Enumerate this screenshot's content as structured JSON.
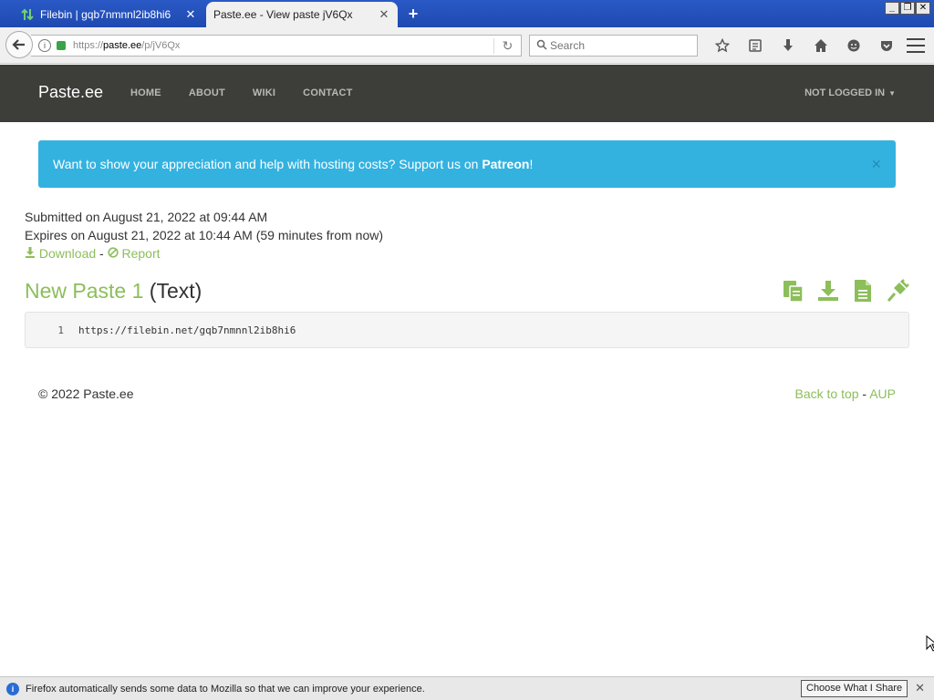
{
  "browser": {
    "tabs": [
      {
        "title": "Filebin | gqb7nmnnl2ib8hi6",
        "active": false,
        "icon": "filebin-arrows-icon"
      },
      {
        "title": "Paste.ee - View paste jV6Qx",
        "active": true,
        "icon": "none"
      }
    ],
    "new_tab_label": "+",
    "url_scheme": "https://",
    "url_host": "paste.ee",
    "url_path": "/p/jV6Qx",
    "search_placeholder": "Search",
    "toolbar_icons": [
      "bookmark-star-icon",
      "reading-list-icon",
      "download-icon",
      "home-icon",
      "smiley-icon",
      "pocket-icon"
    ],
    "window_controls": [
      "_",
      "❐",
      "✕"
    ]
  },
  "site": {
    "brand": "Paste.ee",
    "nav": [
      "HOME",
      "ABOUT",
      "WIKI",
      "CONTACT"
    ],
    "login": "NOT LOGGED IN",
    "alert_text": "Want to show your appreciation and help with hosting costs? Support us on ",
    "alert_link": "Patreon",
    "alert_end": "!",
    "alert_close": "×",
    "accent_color": "#8cbe5a",
    "alert_color": "#33b2e0"
  },
  "paste": {
    "submitted": "Submitted on August 21, 2022 at 09:44 AM",
    "expires": "Expires on August 21, 2022 at 10:44 AM (59 minutes from now)",
    "download_label": "Download",
    "link_sep": " - ",
    "report_label": "Report",
    "name": "New Paste 1",
    "type": "(Text)",
    "actions": [
      "copy-icon",
      "download-icon",
      "raw-document-icon",
      "plug-icon"
    ],
    "lines": [
      {
        "number": "1",
        "text": "https://filebin.net/gqb7nmnnl2ib8hi6"
      }
    ]
  },
  "footer": {
    "copyright": "© 2022 Paste.ee",
    "back_to_top": "Back to top",
    "sep": " - ",
    "aup": "AUP"
  },
  "notification": {
    "text": "Firefox automatically sends some data to Mozilla so that we can improve your experience.",
    "button": "Choose What I Share",
    "close": "✕"
  }
}
